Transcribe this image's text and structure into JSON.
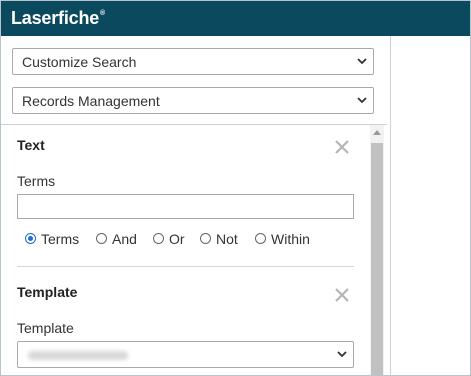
{
  "header": {
    "logo_text": "Laserfiche",
    "logo_mark": "®"
  },
  "search": {
    "customize_select": "Customize Search",
    "repository_select": "Records Management"
  },
  "text_section": {
    "title": "Text",
    "terms_label": "Terms",
    "terms_value": "",
    "options": [
      {
        "label": "Terms",
        "selected": true
      },
      {
        "label": "And",
        "selected": false
      },
      {
        "label": "Or",
        "selected": false
      },
      {
        "label": "Not",
        "selected": false
      },
      {
        "label": "Within",
        "selected": false
      }
    ]
  },
  "template_section": {
    "title": "Template",
    "template_label": "Template"
  },
  "icons": {
    "close": "close-icon",
    "chevron": "chevron-down-icon",
    "scroll_up": "scroll-up-arrow-icon"
  },
  "colors": {
    "header_bg": "#0b4a5e",
    "radio_selected": "#1a6fd1"
  }
}
